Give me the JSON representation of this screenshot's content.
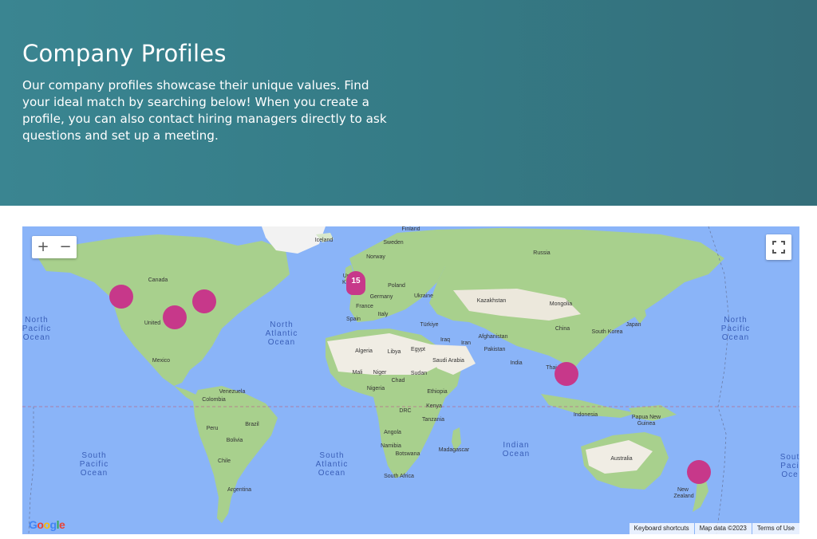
{
  "hero": {
    "title": "Company Profiles",
    "description": "Our company profiles showcase their unique values. Find your ideal match by searching below! When you create a profile, you can also contact hiring managers directly to ask questions and set up a meeting."
  },
  "map": {
    "zoom_in_label": "+",
    "zoom_out_label": "−",
    "cluster_count": "15",
    "google_logo": "Google",
    "attribution": {
      "keyboard": "Keyboard shortcuts",
      "map_data": "Map data ©2023",
      "terms": "Terms of Use"
    },
    "oceans": {
      "north_pacific_left": [
        "North",
        "Pacific",
        "Ocean"
      ],
      "north_atlantic": [
        "North",
        "Atlantic",
        "Ocean"
      ],
      "north_pacific_right": [
        "North",
        "Pacific",
        "Ocean"
      ],
      "south_pacific_left": [
        "South",
        "Pacific",
        "Ocean"
      ],
      "south_atlantic": [
        "South",
        "Atlantic",
        "Ocean"
      ],
      "indian": [
        "Indian",
        "Ocean"
      ],
      "south_pacific_right": [
        "Sout",
        "Paci",
        "Oce"
      ]
    },
    "places": {
      "iceland": "Iceland",
      "finland": "Finland",
      "sweden": "Sweden",
      "norway": "Norway",
      "russia": "Russia",
      "canada": "Canada",
      "united": "United",
      "mexico": "Mexico",
      "poland": "Poland",
      "germany": "Germany",
      "ukraine": "Ukraine",
      "france": "France",
      "spain": "Spain",
      "italy": "Italy",
      "turkiye": "Türkiye",
      "kazakhstan": "Kazakhstan",
      "mongolia": "Mongolia",
      "china": "China",
      "south_korea": "South Korea",
      "japan": "Japan",
      "afghanistan": "Afghanistan",
      "pakistan": "Pakistan",
      "iraq": "Iraq",
      "iran": "Iran",
      "india": "India",
      "thailand": "Thai",
      "algeria": "Algeria",
      "libya": "Libya",
      "egypt": "Egypt",
      "saudi_arabia": "Saudi Arabia",
      "mali": "Mali",
      "niger": "Niger",
      "chad": "Chad",
      "sudan": "Sudan",
      "nigeria": "Nigeria",
      "ethiopia": "Ethiopia",
      "kenya": "Kenya",
      "drc": "DRC",
      "tanzania": "Tanzania",
      "angola": "Angola",
      "namibia": "Namibia",
      "botswana": "Botswana",
      "madagascar": "Madagascar",
      "south_africa": "South Africa",
      "venezuela": "Venezuela",
      "colombia": "Colombia",
      "brazil": "Brazil",
      "peru": "Peru",
      "bolivia": "Bolivia",
      "chile": "Chile",
      "argentina": "Argentina",
      "indonesia": "Indonesia",
      "papua1": "Papua New",
      "papua2": "Guinea",
      "australia": "Australia",
      "new_zealand1": "New",
      "new_zealand2": "Zealand",
      "united_kingdom": "Unit",
      "united_kingdom2": "Kin"
    },
    "marker_color": "#c7388a"
  }
}
